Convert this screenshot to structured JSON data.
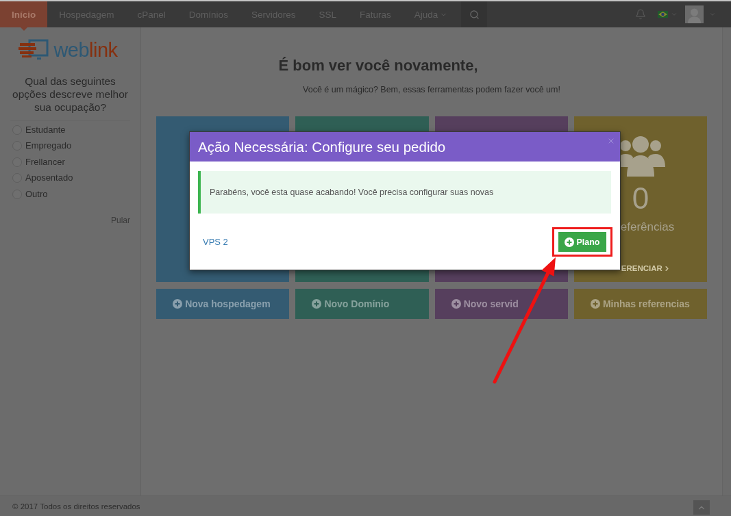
{
  "nav": {
    "items": [
      {
        "label": "Início",
        "selected": true,
        "has_menu": false
      },
      {
        "label": "Hospedagem",
        "selected": false,
        "has_menu": false
      },
      {
        "label": "cPanel",
        "selected": false,
        "has_menu": false
      },
      {
        "label": "Domínios",
        "selected": false,
        "has_menu": false
      },
      {
        "label": "Servidores",
        "selected": false,
        "has_menu": false
      },
      {
        "label": "SSL",
        "selected": false,
        "has_menu": false
      },
      {
        "label": "Faturas",
        "selected": false,
        "has_menu": false
      },
      {
        "label": "Ajuda",
        "selected": false,
        "has_menu": true
      }
    ]
  },
  "sidebar": {
    "logo": {
      "text_parts": [
        "web",
        "link"
      ]
    },
    "question": "Qual das seguintes opções descreve melhor sua ocupação?",
    "options": [
      {
        "label": "Estudante",
        "selected": false
      },
      {
        "label": "Empregado",
        "selected": false
      },
      {
        "label": "Frellancer",
        "selected": false
      },
      {
        "label": "Aposentado",
        "selected": false
      },
      {
        "label": "Outro",
        "selected": false
      }
    ],
    "skip_link": "Pular"
  },
  "main": {
    "heading": "É bom ver você novamente,",
    "subtitle": "Você é um mágico? Bem, essas ferramentas podem fazer você um!",
    "cards": [
      {
        "color": "#345b72"
      },
      {
        "color": "#2f5f55"
      },
      {
        "color": "#563f5d"
      },
      {
        "color": "#6f612d",
        "count": "0",
        "label": "eferências",
        "link": "ERENCIAR"
      }
    ],
    "actions": [
      {
        "label": "Nova hospedagem",
        "color": "#345b72"
      },
      {
        "label": "Novo Domínio",
        "color": "#2f5f55"
      },
      {
        "label": "Novo servid",
        "color": "#563f5d"
      },
      {
        "label": "Minhas referencias",
        "color": "#6f612d"
      }
    ]
  },
  "modal": {
    "title": "Ação Necessária: Configure seu pedido",
    "alert": "Parabéns, você esta quase acabando! Você precisa configurar suas novas",
    "product": "VPS 2",
    "button": "Plano"
  },
  "footer": {
    "copyright": "© 2017 Todos os direitos reservados"
  }
}
